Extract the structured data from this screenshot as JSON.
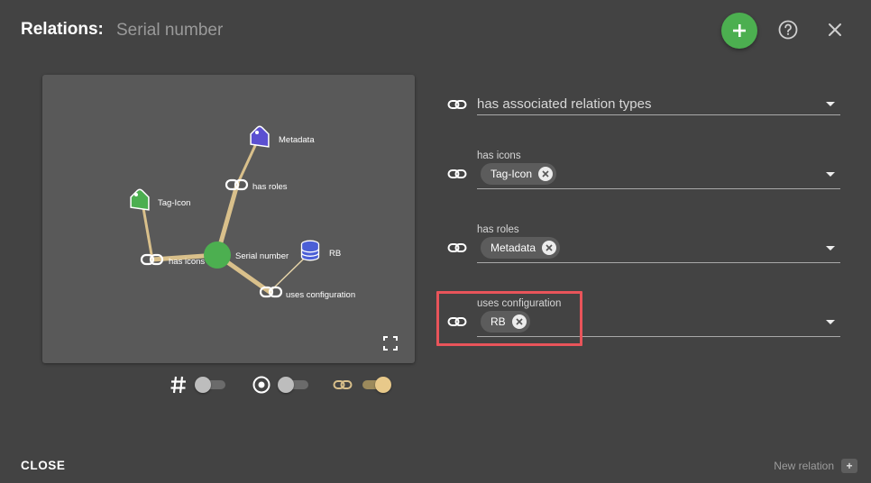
{
  "header": {
    "title": "Relations:",
    "subtitle": "Serial number"
  },
  "colors": {
    "accent_green": "#4caf50",
    "highlight_red": "#e9545a",
    "edge_tan": "#d9c08b",
    "tag_blue": "#5b4fd1",
    "tag_green": "#4caf50",
    "database_blue": "#4b5fd6"
  },
  "icons": {
    "add": "plus-icon",
    "help": "help-circle-icon",
    "close": "close-icon",
    "link": "link-icon",
    "fullscreen": "fullscreen-icon",
    "hash": "hash-icon",
    "target": "target-icon",
    "tag": "tag-icon",
    "database": "database-icon"
  },
  "graph": {
    "center_label": "Serial number",
    "nodes": {
      "metadata": "Metadata",
      "tag_icon": "Tag-Icon",
      "rb": "RB"
    },
    "edge_labels": {
      "has_roles": "has roles",
      "has_icons": "has icons",
      "uses_configuration": "uses configuration"
    }
  },
  "toggles": {
    "hash": false,
    "target": false,
    "link": true
  },
  "fields": {
    "associated": {
      "placeholder": "has associated relation types"
    },
    "has_icons": {
      "label": "has icons",
      "chips": [
        "Tag-Icon"
      ]
    },
    "has_roles": {
      "label": "has roles",
      "chips": [
        "Metadata"
      ]
    },
    "uses_configuration": {
      "label": "uses configuration",
      "chips": [
        "RB"
      ]
    }
  },
  "footer": {
    "close_label": "CLOSE",
    "new_relation_label": "New relation",
    "new_relation_plus": "+"
  }
}
